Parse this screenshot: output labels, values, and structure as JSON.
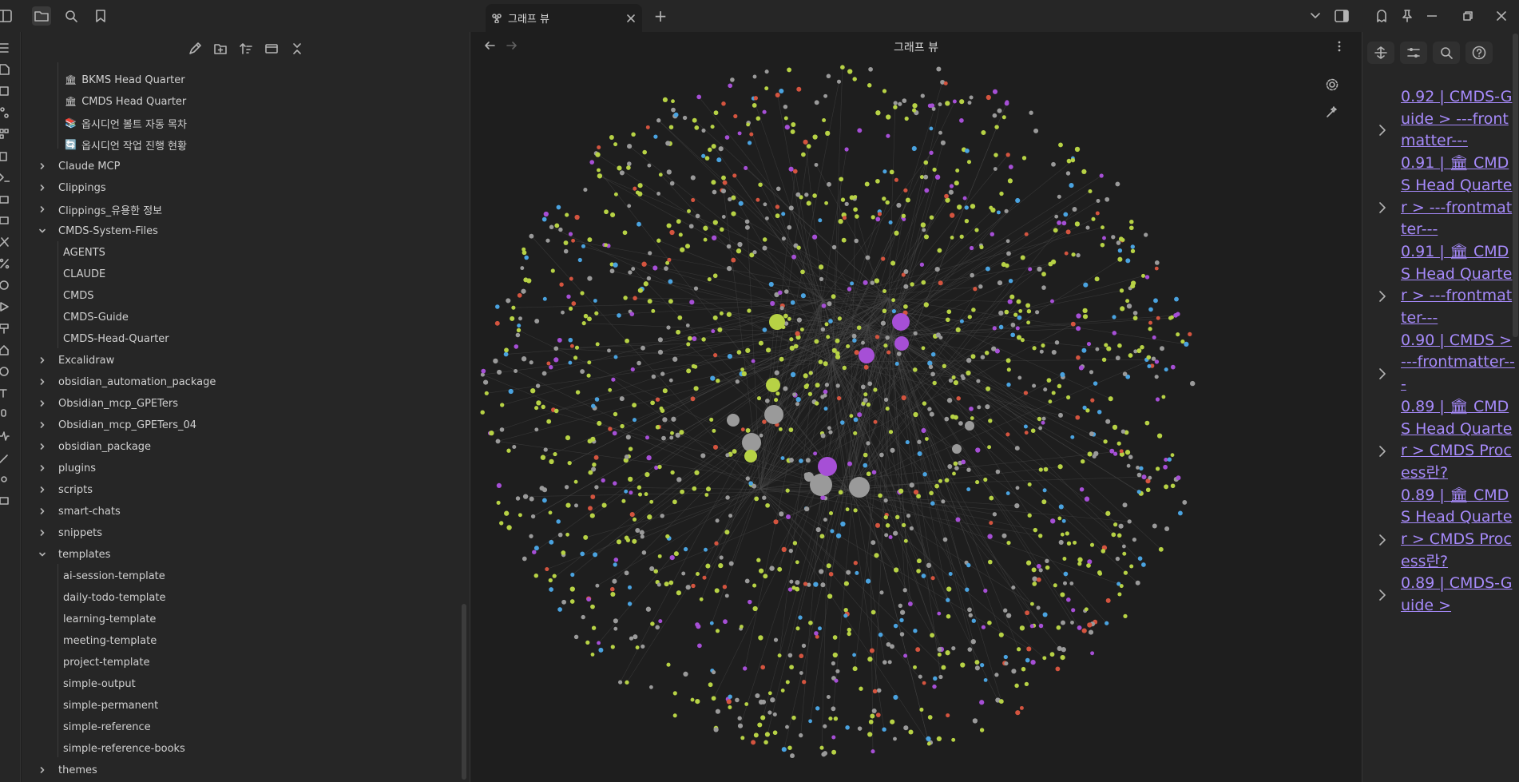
{
  "titlebar": {
    "tab_label": "그래프 뷰",
    "new_tab_symbol": "+"
  },
  "main": {
    "view_title": "그래프 뷰"
  },
  "sidebar": {
    "items": [
      {
        "label": "BKMS Head Quarter",
        "icon": "bank-emoji-icon"
      },
      {
        "label": "CMDS Head Quarter",
        "icon": "bank-emoji-icon"
      },
      {
        "label": "옵시디언 볼트 자동 목차",
        "icon": "books-emoji-icon"
      },
      {
        "label": "옵시디언 작업 진행 현황",
        "icon": "refresh-emoji-icon"
      },
      {
        "label": "Claude MCP"
      },
      {
        "label": "Clippings"
      },
      {
        "label": "Clippings_유용한 정보"
      },
      {
        "label": "CMDS-System-Files",
        "expanded": true
      },
      {
        "label": "AGENTS"
      },
      {
        "label": "CLAUDE"
      },
      {
        "label": "CMDS"
      },
      {
        "label": "CMDS-Guide"
      },
      {
        "label": "CMDS-Head-Quarter"
      },
      {
        "label": "Excalidraw"
      },
      {
        "label": "obsidian_automation_package"
      },
      {
        "label": "Obsidian_mcp_GPETers"
      },
      {
        "label": "Obsidian_mcp_GPETers_04"
      },
      {
        "label": "obsidian_package"
      },
      {
        "label": "plugins"
      },
      {
        "label": "scripts"
      },
      {
        "label": "smart-chats"
      },
      {
        "label": "snippets"
      },
      {
        "label": "templates",
        "expanded": true
      },
      {
        "label": "ai-session-template"
      },
      {
        "label": "daily-todo-template"
      },
      {
        "label": "learning-template"
      },
      {
        "label": "meeting-template"
      },
      {
        "label": "project-template"
      },
      {
        "label": "simple-output"
      },
      {
        "label": "simple-permanent"
      },
      {
        "label": "simple-reference"
      },
      {
        "label": "simple-reference-books"
      },
      {
        "label": "themes"
      }
    ]
  },
  "right_panel": {
    "results": [
      {
        "text": "0.92 | CMDS-Guide > ---frontmatter---"
      },
      {
        "text": "0.91 | 🏛 CMDS Head Quarter > ---frontmatter---"
      },
      {
        "text": "0.91 | 🏛 CMDS Head Quarter > ---frontmatter---"
      },
      {
        "text": "0.90 | CMDS > ---frontmatter---"
      },
      {
        "text": "0.89 | 🏛 CMDS Head Quarter > CMDS Process란?"
      },
      {
        "text": "0.89 | 🏛 CMDS Head Quarter > CMDS Process란?"
      },
      {
        "text": "0.89 | CMDS-Guide >"
      }
    ]
  },
  "colors": {
    "node_green": "#b7d245",
    "node_grey": "#9a9a9a",
    "node_purple": "#a64fd6",
    "node_red": "#d4543f",
    "node_blue": "#4aa3e0",
    "link": "#a68afa"
  }
}
